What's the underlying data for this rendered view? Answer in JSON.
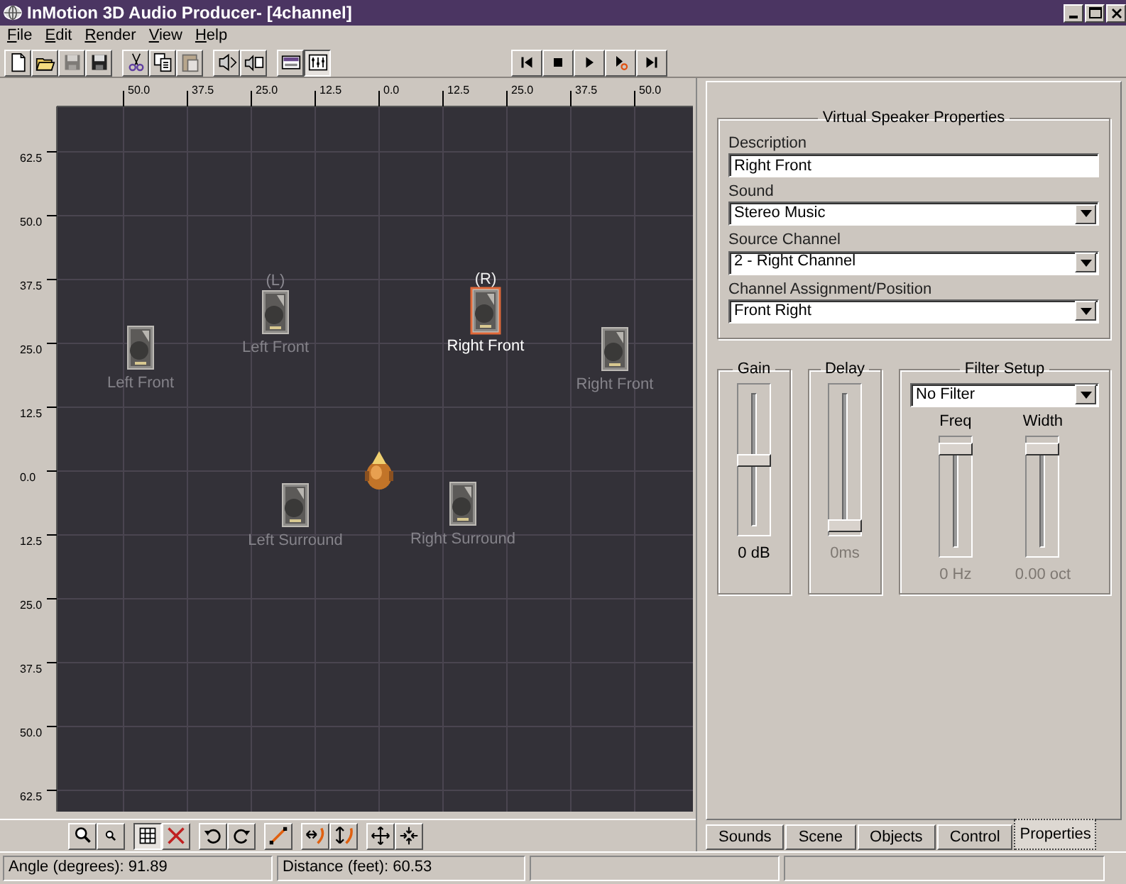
{
  "window": {
    "title": "InMotion 3D Audio Producer- [4channel]"
  },
  "menu": [
    "File",
    "Edit",
    "Render",
    "View",
    "Help"
  ],
  "toolbar": [
    {
      "buttons": [
        {
          "kind": "new",
          "disabled": false,
          "pressed": false
        },
        {
          "kind": "open",
          "disabled": false,
          "pressed": false
        },
        {
          "kind": "save",
          "disabled": true,
          "pressed": false
        },
        {
          "kind": "save",
          "disabled": false,
          "pressed": false
        }
      ]
    },
    {
      "buttons": [
        {
          "kind": "cut",
          "disabled": false,
          "pressed": false
        },
        {
          "kind": "copy",
          "disabled": false,
          "pressed": false
        },
        {
          "kind": "paste",
          "disabled": true,
          "pressed": false
        }
      ]
    },
    {
      "buttons": [
        {
          "kind": "speaker-out",
          "disabled": false,
          "pressed": false
        },
        {
          "kind": "speaker-in",
          "disabled": false,
          "pressed": false
        }
      ]
    },
    {
      "buttons": [
        {
          "kind": "panel",
          "disabled": false,
          "pressed": false
        },
        {
          "kind": "mixer",
          "disabled": false,
          "pressed": true
        }
      ]
    }
  ],
  "transport": [
    {
      "kind": "first"
    },
    {
      "kind": "stop"
    },
    {
      "kind": "play"
    },
    {
      "kind": "play-record"
    },
    {
      "kind": "last"
    }
  ],
  "canvas": {
    "x_ruler": [
      "50.0",
      "37.5",
      "25.0",
      "12.5",
      "0.0",
      "12.5",
      "25.0",
      "37.5",
      "50.0"
    ],
    "y_ruler": [
      "62.5",
      "50.0",
      "37.5",
      "25.0",
      "12.5",
      "0.0",
      "12.5",
      "25.0",
      "37.5",
      "50.0",
      "62.5"
    ],
    "speakers": [
      {
        "label": "Left Front",
        "selected": false
      },
      {
        "tag": "(L)",
        "label": "Left Front",
        "selected": false
      },
      {
        "tag": "(R)",
        "label": "Right Front",
        "selected": true
      },
      {
        "label": "Right Front",
        "selected": false
      },
      {
        "label": "Left Surround",
        "selected": false
      },
      {
        "label": "Right Surround",
        "selected": false
      }
    ]
  },
  "canvas_tools": [
    {
      "buttons": [
        {
          "kind": "zoom-in",
          "pressed": false
        },
        {
          "kind": "zoom-out",
          "pressed": false
        }
      ]
    },
    {
      "buttons": [
        {
          "kind": "grid",
          "pressed": true
        },
        {
          "kind": "delete",
          "pressed": false
        }
      ]
    },
    {
      "buttons": [
        {
          "kind": "rotate-left",
          "pressed": false
        },
        {
          "kind": "rotate-right",
          "pressed": false
        }
      ]
    },
    {
      "buttons": [
        {
          "kind": "line",
          "pressed": false
        }
      ]
    },
    {
      "buttons": [
        {
          "kind": "spread-horizontal",
          "pressed": false
        },
        {
          "kind": "spread-vertical",
          "pressed": false
        }
      ]
    },
    {
      "buttons": [
        {
          "kind": "expand",
          "pressed": false
        },
        {
          "kind": "contract",
          "pressed": false
        }
      ]
    }
  ],
  "properties": {
    "title": "Virtual Speaker Properties",
    "fields": [
      {
        "label": "Description",
        "kind": "text",
        "value": "Right Front"
      },
      {
        "label": "Sound",
        "kind": "select",
        "value": "Stereo Music"
      },
      {
        "label": "Source Channel",
        "kind": "select",
        "value": "2 - Right Channel"
      },
      {
        "label": "Channel Assignment/Position",
        "kind": "select",
        "value": "Front Right"
      }
    ]
  },
  "gain": {
    "title": "Gain",
    "level": 0.5,
    "reading": "0 dB",
    "disabled": false
  },
  "delay": {
    "title": "Delay",
    "level": 0,
    "reading": "0ms",
    "disabled": true
  },
  "filter": {
    "title": "Filter Setup",
    "value": "No Filter",
    "sliders": [
      {
        "label": "Freq",
        "level": 1,
        "reading": "0 Hz",
        "disabled": true
      },
      {
        "label": "Width",
        "level": 1,
        "reading": "0.00 oct",
        "disabled": true
      }
    ]
  },
  "tabs": [
    {
      "label": "Sounds",
      "selected": false
    },
    {
      "label": "Scene",
      "selected": false
    },
    {
      "label": "Objects",
      "selected": false
    },
    {
      "label": "Control",
      "selected": false
    },
    {
      "label": "Properties",
      "selected": true
    }
  ],
  "status_bar": [
    "Angle (degrees): 91.89",
    "Distance (feet): 60.53"
  ]
}
